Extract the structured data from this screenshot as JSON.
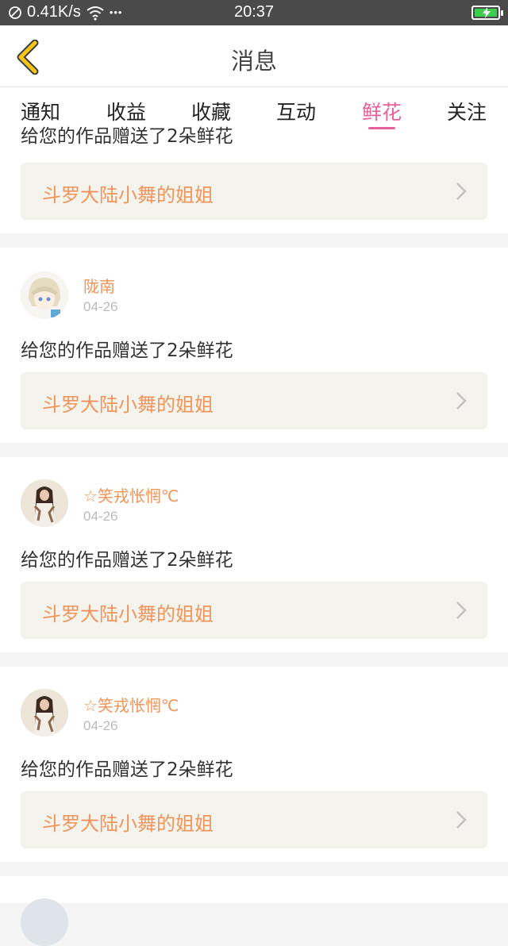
{
  "status_bar": {
    "network_speed": "0.41K/s",
    "time": "20:37",
    "more": "•••"
  },
  "nav": {
    "title": "消息"
  },
  "tabs": [
    {
      "label": "通知"
    },
    {
      "label": "收益"
    },
    {
      "label": "收藏"
    },
    {
      "label": "互动"
    },
    {
      "label": "鲜花"
    },
    {
      "label": "关注"
    }
  ],
  "partial_message": "给您的作品赠送了2朵鲜花",
  "notifications": [
    {
      "work_title": "斗罗大陆小舞的姐姐"
    },
    {
      "username": "陇南",
      "date": "04-26",
      "message": "给您的作品赠送了2朵鲜花",
      "work_title": "斗罗大陆小舞的姐姐"
    },
    {
      "username": "☆笑戎怅惘℃",
      "date": "04-26",
      "message": "给您的作品赠送了2朵鲜花",
      "work_title": "斗罗大陆小舞的姐姐"
    },
    {
      "username": "☆笑戎怅惘℃",
      "date": "04-26",
      "message": "给您的作品赠送了2朵鲜花",
      "work_title": "斗罗大陆小舞的姐姐"
    }
  ],
  "colors": {
    "accent": "#e8619a",
    "username": "#f0955a",
    "back_icon": "#f5c518"
  }
}
